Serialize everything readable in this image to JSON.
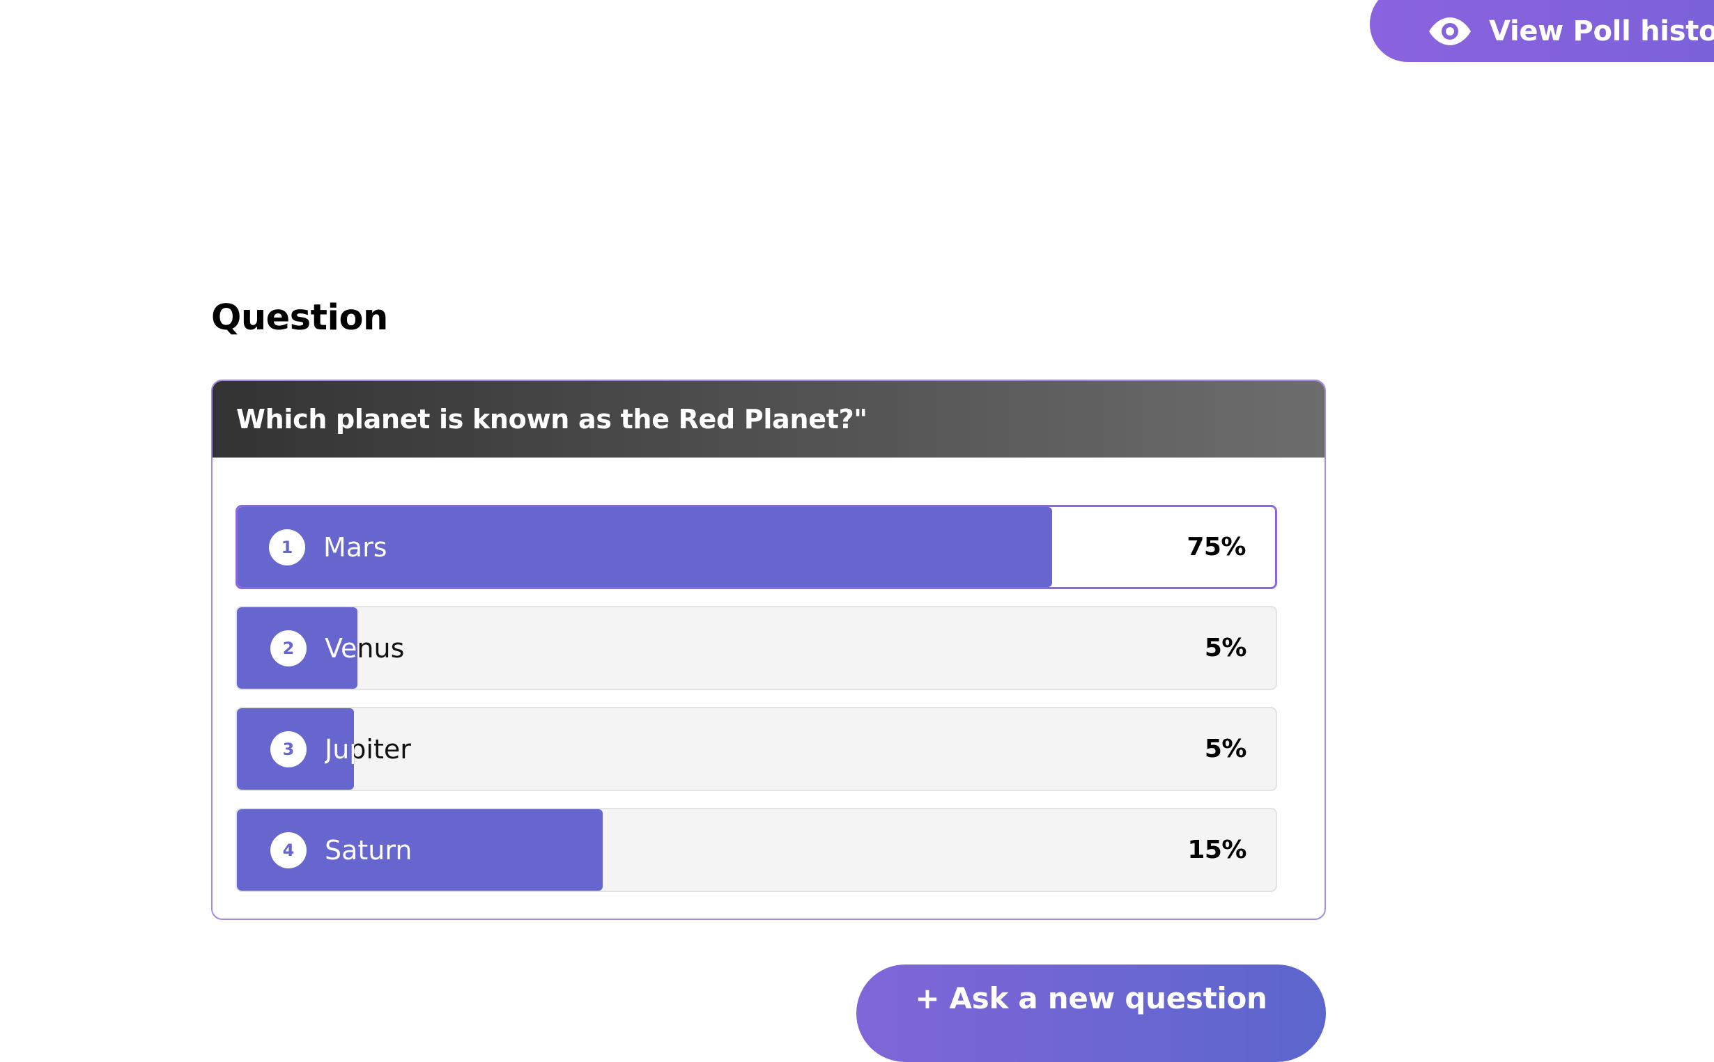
{
  "history_button": {
    "icon": "eye-icon",
    "label": "View Poll history"
  },
  "section": {
    "title": "Question"
  },
  "poll": {
    "question": "Which planet is known as the Red Planet?\"",
    "accent_color": "#6766cf",
    "options": [
      {
        "number": "1",
        "label": "Mars",
        "percent_label": "75%",
        "fill_fraction": 0.785,
        "selected": true
      },
      {
        "number": "2",
        "label": "Venus",
        "percent_label": "5%",
        "fill_fraction": 0.116,
        "selected": false
      },
      {
        "number": "3",
        "label": "Jupiter",
        "percent_label": "5%",
        "fill_fraction": 0.113,
        "selected": false
      },
      {
        "number": "4",
        "label": "Saturn",
        "percent_label": "15%",
        "fill_fraction": 0.352,
        "selected": false
      }
    ]
  },
  "ask_button": {
    "label": "+ Ask a new question"
  }
}
